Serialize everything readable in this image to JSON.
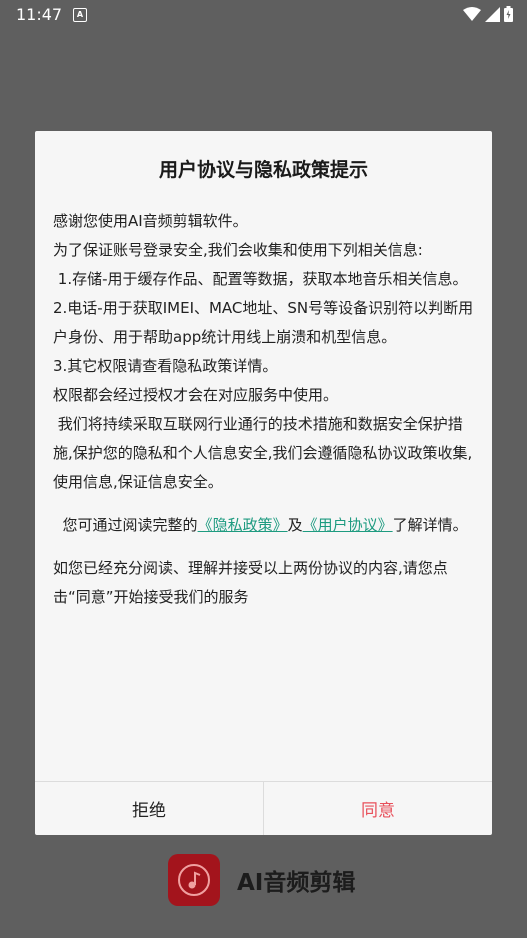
{
  "status_bar": {
    "time": "11:47",
    "notification_letter": "A"
  },
  "dialog": {
    "title": "用户协议与隐私政策提示",
    "paragraphs": [
      "感谢您使用AI音频剪辑软件。",
      "为了保证账号登录安全,我们会收集和使用下列相关信息:",
      " 1.存储-用于缓存作品、配置等数据，获取本地音乐相关信息。",
      "2.电话-用于获取IMEI、MAC地址、SN号等设备识别符以判断用户身份、用于帮助app统计用线上崩溃和机型信息。",
      "3.其它权限请查看隐私政策详情。",
      "权限都会经过授权才会在对应服务中使用。",
      " 我们将持续采取互联网行业通行的技术措施和数据安全保护措施,保护您的隐私和个人信息安全,我们会遵循隐私协议政策收集,使用信息,保证信息安全。"
    ],
    "links_line": {
      "prefix": "  您可通过阅读完整的",
      "privacy_link": "《隐私政策》",
      "middle": "及",
      "user_link": "《用户协议》",
      "suffix": "了解详情。"
    },
    "closing": "如您已经充分阅读、理解并接受以上两份协议的内容,请您点击“同意”开始接受我们的服务",
    "reject_label": "拒绝",
    "agree_label": "同意"
  },
  "brand": {
    "name": "AI音频剪辑",
    "logo_icon": "music-note-icon"
  }
}
